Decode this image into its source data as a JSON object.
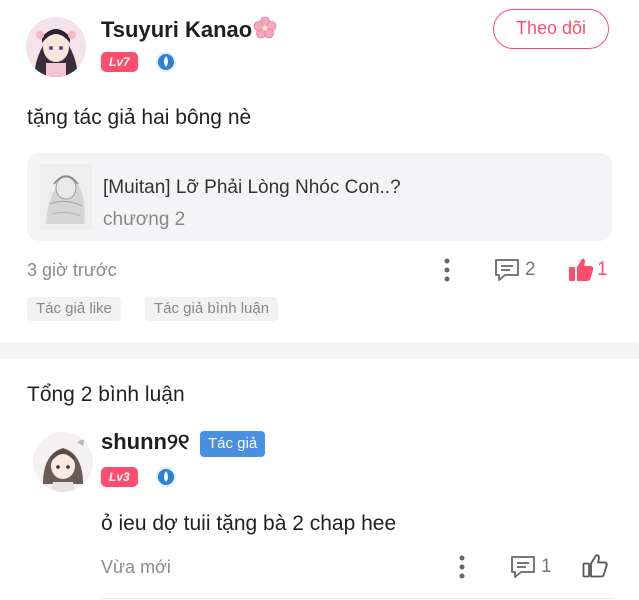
{
  "post": {
    "username": "Tsuyuri Kanao",
    "level": "Lv7",
    "follow_label": "Theo dõi",
    "text": "tặng tác giả hai bông nè",
    "story": {
      "title": "[Muitan] Lỡ Phải Lòng Nhóc Con..?",
      "chapter": "chương 2"
    },
    "time": "3 giờ trước",
    "comment_count": "2",
    "like_count": "1",
    "tags": [
      "Tác giả like",
      "Tác giả bình luận"
    ]
  },
  "replies_section": {
    "total_label": "Tổng 2 bình luận"
  },
  "reply": {
    "username": "shunn୨୧",
    "author_badge": "Tác giả",
    "level": "Lv3",
    "text": "ỏ ieu dợ tuii tặng bà 2 chap hee",
    "time": "Vừa mới",
    "comment_count": "1"
  },
  "colors": {
    "accent": "#ff4d6d",
    "author_badge": "#4a90e2",
    "muted_text": "#888888"
  },
  "icons": {
    "flower": "cherry-blossom-icon",
    "rank": "blue-drop-rank-icon",
    "more": "more-vertical-icon",
    "comment": "comment-icon",
    "like_filled": "thumbs-up-filled-icon",
    "like_outline": "thumbs-up-outline-icon"
  }
}
